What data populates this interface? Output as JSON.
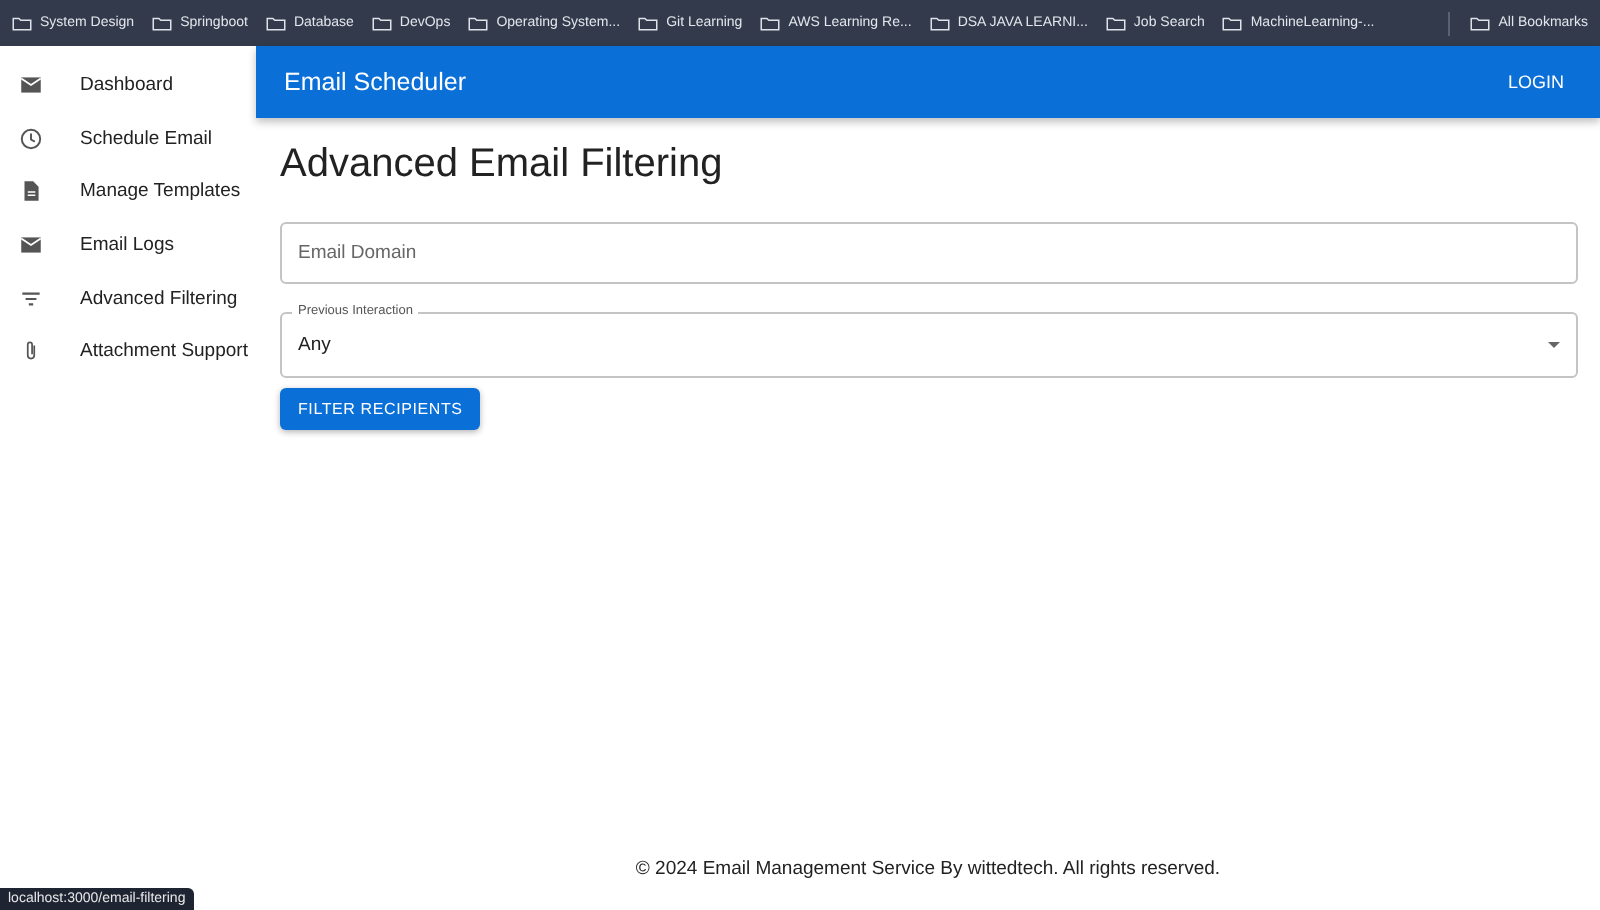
{
  "bookmarks_bar": {
    "items": [
      {
        "label": "System Design"
      },
      {
        "label": "Springboot"
      },
      {
        "label": "Database"
      },
      {
        "label": "DevOps"
      },
      {
        "label": "Operating System..."
      },
      {
        "label": "Git Learning"
      },
      {
        "label": "AWS Learning Re..."
      },
      {
        "label": "DSA JAVA LEARNI..."
      },
      {
        "label": "Job Search"
      },
      {
        "label": "MachineLearning-..."
      }
    ],
    "all_bookmarks": "All Bookmarks"
  },
  "sidebar": {
    "items": [
      {
        "label": "Dashboard"
      },
      {
        "label": "Schedule Email"
      },
      {
        "label": "Manage Templates"
      },
      {
        "label": "Email Logs"
      },
      {
        "label": "Advanced Filtering"
      },
      {
        "label": "Attachment Support"
      }
    ]
  },
  "app_bar": {
    "title": "Email Scheduler",
    "login": "LOGIN"
  },
  "page": {
    "title": "Advanced Email Filtering",
    "email_domain": {
      "placeholder": "Email Domain"
    },
    "previous_interaction": {
      "label": "Previous Interaction",
      "value": "Any"
    },
    "button": "FILTER RECIPIENTS"
  },
  "footer": "© 2024 Email Management Service By wittedtech. All rights reserved.",
  "status_url": "localhost:3000/email-filtering"
}
